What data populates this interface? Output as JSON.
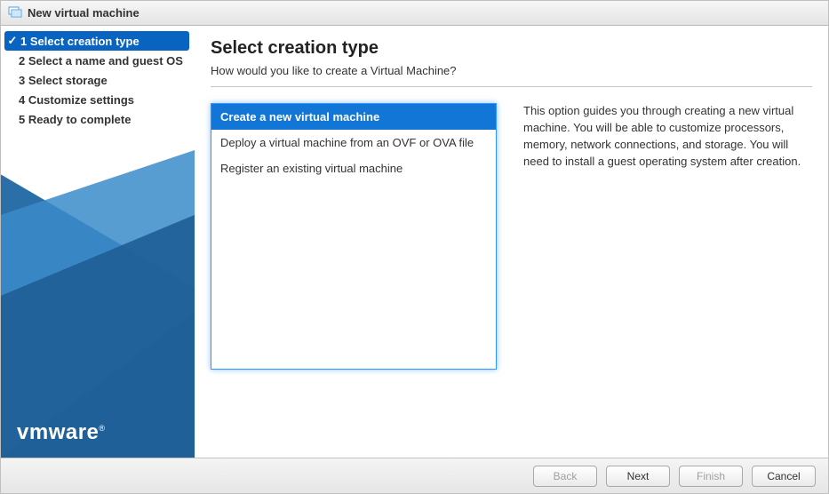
{
  "window": {
    "title": "New virtual machine"
  },
  "sidebar": {
    "steps": [
      {
        "label": "1 Select creation type"
      },
      {
        "label": "2 Select a name and guest OS"
      },
      {
        "label": "3 Select storage"
      },
      {
        "label": "4 Customize settings"
      },
      {
        "label": "5 Ready to complete"
      }
    ],
    "brand": "vmware"
  },
  "main": {
    "heading": "Select creation type",
    "subtitle": "How would you like to create a Virtual Machine?",
    "options": [
      {
        "label": "Create a new virtual machine"
      },
      {
        "label": "Deploy a virtual machine from an OVF or OVA file"
      },
      {
        "label": "Register an existing virtual machine"
      }
    ],
    "description": "This option guides you through creating a new virtual machine. You will be able to customize processors, memory, network connections, and storage. You will need to install a guest operating system after creation."
  },
  "footer": {
    "back": "Back",
    "next": "Next",
    "finish": "Finish",
    "cancel": "Cancel"
  }
}
